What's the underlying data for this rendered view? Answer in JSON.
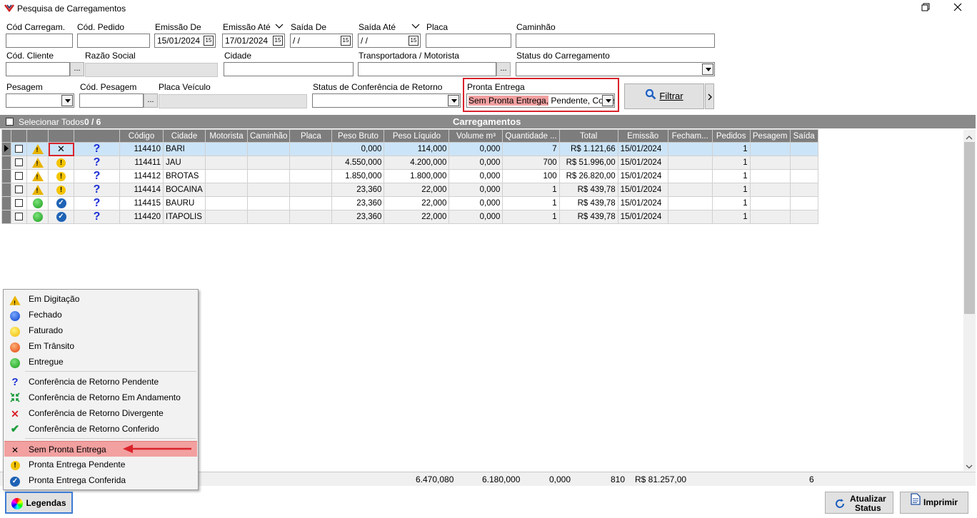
{
  "window": {
    "title": "Pesquisa de Carregamentos",
    "restore_icon": "restore-icon",
    "close_icon": "close-icon"
  },
  "filters": {
    "cod_carregam": {
      "label": "Cód Carregam.",
      "value": ""
    },
    "cod_pedido": {
      "label": "Cód. Pedido",
      "value": ""
    },
    "emissao_de": {
      "label": "Emissão De",
      "value": "15/01/2024"
    },
    "emissao_ate": {
      "label": "Emissão Até",
      "value": "17/01/2024"
    },
    "saida_de": {
      "label": "Saída De",
      "value": " /  /"
    },
    "saida_ate": {
      "label": "Saída Até",
      "value": " /  /"
    },
    "placa": {
      "label": "Placa",
      "value": ""
    },
    "caminhao": {
      "label": "Caminhão",
      "value": ""
    },
    "cod_cliente": {
      "label": "Cód. Cliente",
      "value": ""
    },
    "razao_social": {
      "label": "Razão Social",
      "value": ""
    },
    "cidade": {
      "label": "Cidade",
      "value": ""
    },
    "transportadora": {
      "label": "Transportadora / Motorista",
      "value": ""
    },
    "status_carregamento": {
      "label": "Status do Carregamento",
      "value": ""
    },
    "pesagem": {
      "label": "Pesagem",
      "value": ""
    },
    "cod_pesagem": {
      "label": "Cód. Pesagem",
      "value": ""
    },
    "placa_veiculo": {
      "label": "Placa Veículo",
      "value": ""
    },
    "status_conferencia": {
      "label": "Status de Conferência de Retorno",
      "value": ""
    },
    "pronta_entrega": {
      "label": "Pronta Entrega",
      "value_highlight": "Sem Pronta Entrega,",
      "value_rest": " Pendente, Confer"
    },
    "dots": "...",
    "filtrar": "Filtrar"
  },
  "grid": {
    "select_all": "Selecionar Todos",
    "count": "0 / 6",
    "title": "Carregamentos",
    "columns": [
      "",
      "",
      "",
      "",
      "Código",
      "Cidade",
      "Motorista",
      "Caminhão",
      "Placa",
      "Peso Bruto",
      "Peso Líquido",
      "Volume m³",
      "Quantidade ...",
      "Total",
      "Emissão",
      "Fecham...",
      "Pedidos",
      "Pesagem",
      "Saída"
    ],
    "rows": [
      {
        "status": "warning",
        "pronta": "x",
        "conf": "?",
        "codigo": "114410",
        "cidade": "BARI",
        "peso_bruto": "0,000",
        "peso_liquido": "114,000",
        "volume": "0,000",
        "quantidade": "7",
        "total": "R$ 1.121,66",
        "emissao": "15/01/2024",
        "pedidos": "1"
      },
      {
        "status": "warning",
        "pronta": "!",
        "conf": "?",
        "codigo": "114411",
        "cidade": "JAU",
        "peso_bruto": "4.550,000",
        "peso_liquido": "4.200,000",
        "volume": "0,000",
        "quantidade": "700",
        "total": "R$ 51.996,00",
        "emissao": "15/01/2024",
        "pedidos": "1"
      },
      {
        "status": "warning",
        "pronta": "!",
        "conf": "?",
        "codigo": "114412",
        "cidade": "BROTAS",
        "peso_bruto": "1.850,000",
        "peso_liquido": "1.800,000",
        "volume": "0,000",
        "quantidade": "100",
        "total": "R$ 26.820,00",
        "emissao": "15/01/2024",
        "pedidos": "1"
      },
      {
        "status": "warning",
        "pronta": "!",
        "conf": "?",
        "codigo": "114414",
        "cidade": "BOCAINA",
        "peso_bruto": "23,360",
        "peso_liquido": "22,000",
        "volume": "0,000",
        "quantidade": "1",
        "total": "R$ 439,78",
        "emissao": "15/01/2024",
        "pedidos": "1"
      },
      {
        "status": "green",
        "pronta": "check",
        "conf": "?",
        "codigo": "114415",
        "cidade": "BAURU",
        "peso_bruto": "23,360",
        "peso_liquido": "22,000",
        "volume": "0,000",
        "quantidade": "1",
        "total": "R$ 439,78",
        "emissao": "15/01/2024",
        "pedidos": "1"
      },
      {
        "status": "green",
        "pronta": "check",
        "conf": "?",
        "codigo": "114420",
        "cidade": "ITAPOLIS",
        "peso_bruto": "23,360",
        "peso_liquido": "22,000",
        "volume": "0,000",
        "quantidade": "1",
        "total": "R$ 439,78",
        "emissao": "15/01/2024",
        "pedidos": "1"
      }
    ],
    "totals": {
      "peso_bruto": "6.470,080",
      "peso_liquido": "6.180,000",
      "volume": "0,000",
      "quantidade": "810",
      "total": "R$ 81.257,00",
      "pedidos": "6"
    }
  },
  "legend": {
    "items": [
      {
        "icon": "warning-icon",
        "label": "Em Digitação"
      },
      {
        "icon": "blue-dot-icon",
        "label": "Fechado"
      },
      {
        "icon": "yellow-dot-icon",
        "label": "Faturado"
      },
      {
        "icon": "orange-dot-icon",
        "label": "Em Trânsito"
      },
      {
        "icon": "green-dot-icon",
        "label": "Entregue"
      },
      {
        "icon": "question-icon",
        "label": "Conferência de Retorno Pendente"
      },
      {
        "icon": "arrows-in-icon",
        "label": "Conferência de Retorno Em Andamento"
      },
      {
        "icon": "red-x-icon",
        "label": "Conferência de Retorno Divergente"
      },
      {
        "icon": "green-check-icon",
        "label": "Conferência de Retorno Conferido"
      },
      {
        "icon": "x-icon",
        "label": "Sem Pronta Entrega"
      },
      {
        "icon": "yellow-exclaim-icon",
        "label": "Pronta Entrega Pendente"
      },
      {
        "icon": "blue-check-icon",
        "label": "Pronta Entrega Conferida"
      }
    ]
  },
  "buttons": {
    "legendas": "Legendas",
    "atualizar_line1": "Atualizar",
    "atualizar_line2": "Status",
    "imprimir": "Imprimir"
  },
  "colors": {
    "highlight_red": "#d9232b",
    "selected_row": "#cce4f7",
    "grid_header": "#7d7d7d",
    "pink_highlight": "#f2a0a0"
  }
}
